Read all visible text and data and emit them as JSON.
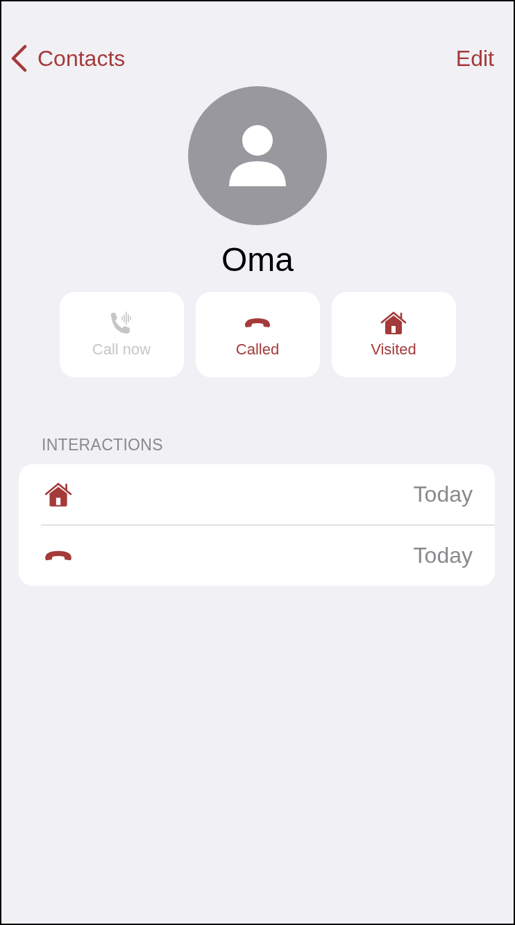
{
  "nav": {
    "back_label": "Contacts",
    "action": "Edit"
  },
  "contact": {
    "name": "Oma"
  },
  "actions": [
    {
      "kind": "call",
      "label": "Call now",
      "disabled": true
    },
    {
      "kind": "called",
      "label": "Called",
      "disabled": false
    },
    {
      "kind": "visited",
      "label": "Visited",
      "disabled": false
    }
  ],
  "interactions": {
    "header": "INTERACTIONS",
    "rows": [
      {
        "kind": "visited",
        "date": "Today"
      },
      {
        "kind": "called",
        "date": "Today"
      }
    ]
  }
}
